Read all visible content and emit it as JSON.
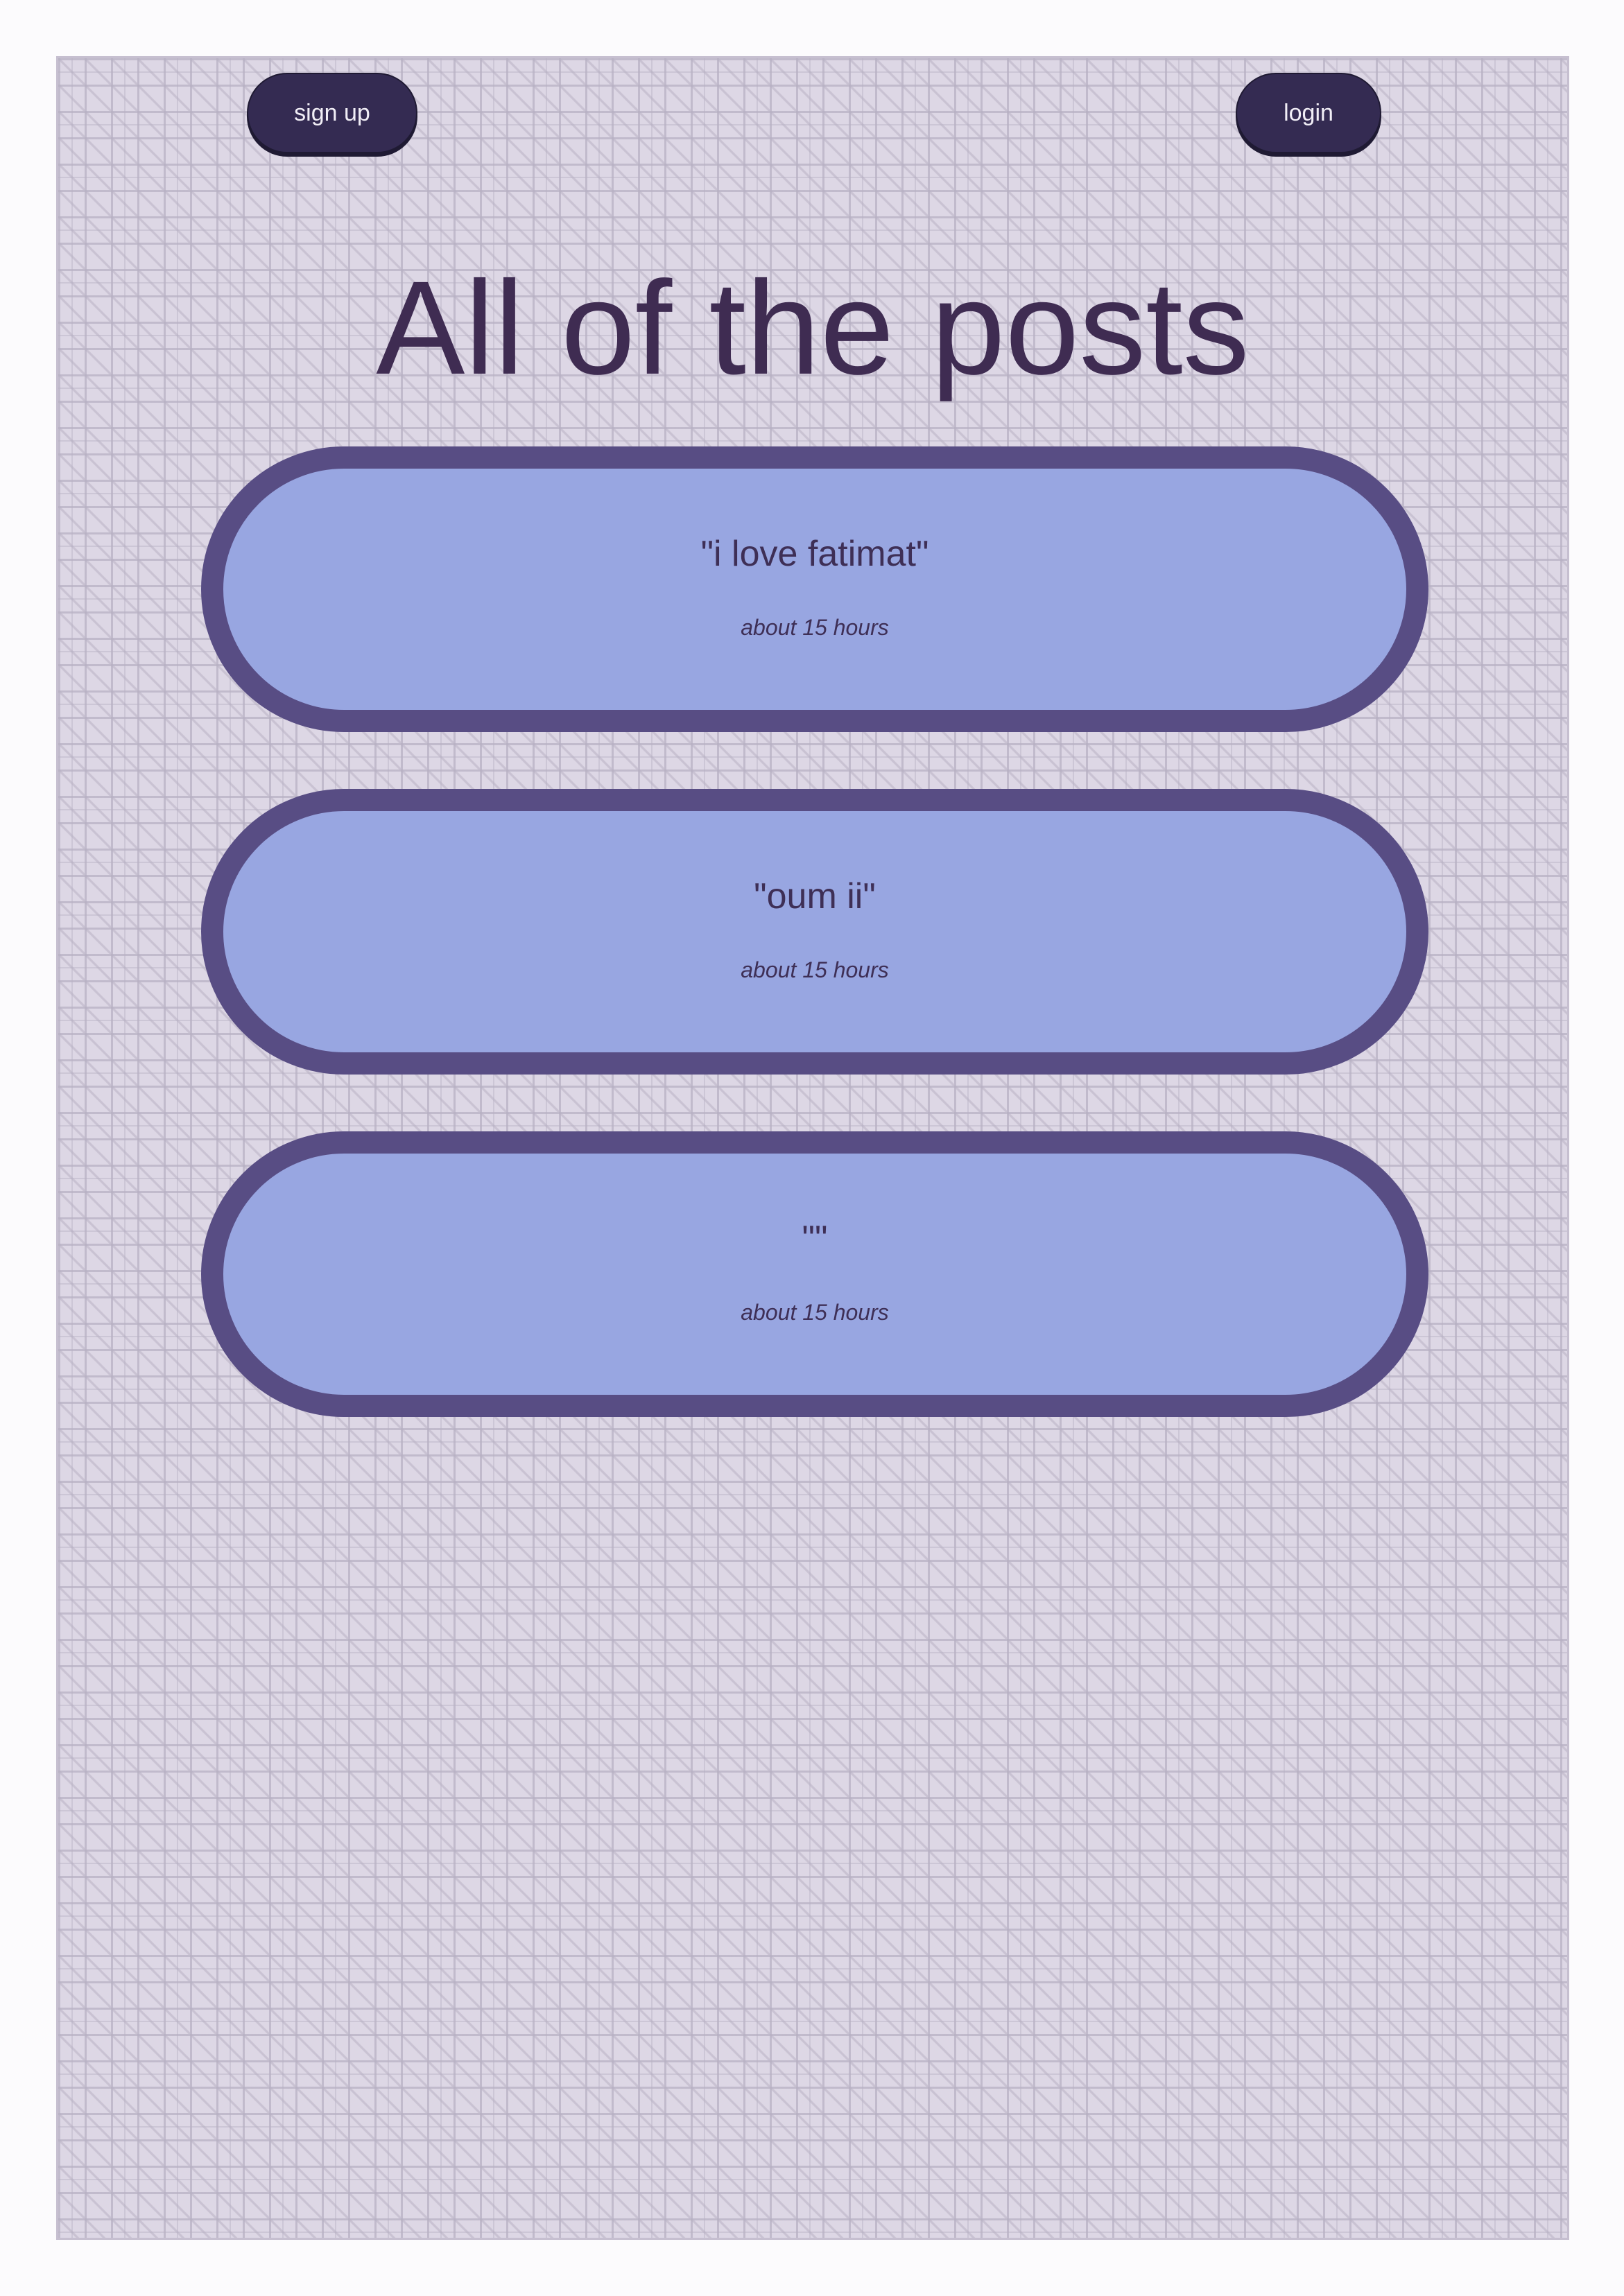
{
  "header": {
    "signup_label": "sign up",
    "login_label": "login"
  },
  "page": {
    "title": "All of the posts"
  },
  "posts": [
    {
      "text": "\"i love fatimat\"",
      "time": "about 15 hours"
    },
    {
      "text": "\"oum ii\"",
      "time": "about 15 hours"
    },
    {
      "text": "\"\"",
      "time": "about 15 hours"
    }
  ],
  "colors": {
    "button_bg": "#342b52",
    "title": "#3f2c52",
    "card_border": "#584d84",
    "card_fill": "#98a6e1",
    "page_bg": "#ddd7e5"
  }
}
